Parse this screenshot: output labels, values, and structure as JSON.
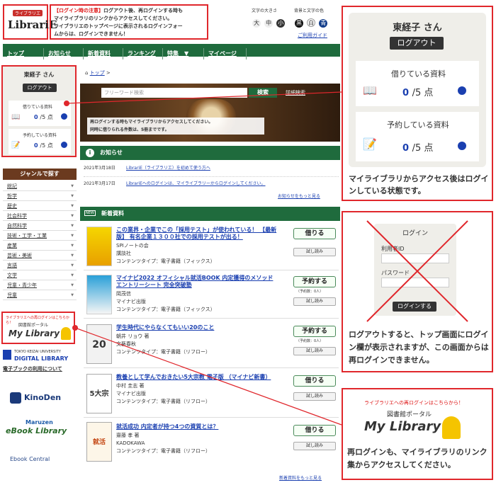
{
  "header": {
    "notice_title": "【ログイン時の注意】",
    "notice_lines": [
      "ログアウト後、再ログインする時も",
      "マイライブラリのリンクからアクセスしてください。",
      "ライブラリエのトップページに表示されるログインフォー",
      "ムからは、ログインできません！"
    ],
    "logo": "LibrariE",
    "logo_tag": "ライブラリエ",
    "text_size_label": "文字の大きさ",
    "text_sizes": [
      "大",
      "中",
      "小"
    ],
    "bg_label": "背景と文字の色",
    "bg_options": [
      "黒",
      "白",
      "青"
    ],
    "guide_link": "ご利用ガイド"
  },
  "nav": [
    "トップ",
    "お知らせ",
    "新着資料",
    "ランキング",
    "特集　▼",
    "マイページ"
  ],
  "user": {
    "name": "東経子 さん",
    "logout": "ログアウト",
    "borrowed_label": "借りている資料",
    "borrowed": "0",
    "borrowed_max": "/5 点",
    "reserved_label": "予約している資料",
    "reserved": "0",
    "reserved_max": "/5 点"
  },
  "sidebar": {
    "genre_title": "ジャンルで探す",
    "genres": [
      "総記",
      "哲学",
      "歴史",
      "社会科学",
      "自然科学",
      "技術・工学・工業",
      "産業",
      "芸術・美術",
      "言語",
      "文学",
      "児童・青少年",
      "児童"
    ],
    "mylib_note": "ライブラリエへの再ログインはこちらから！",
    "mylib_sub": "図書館ポータル",
    "mylib": "My Library",
    "dl_univ": "TOKYO KEIZAI UNIVERSITY",
    "dl_name": "DIGITAL LIBRARY",
    "ebook_use": "電子ブックの利用について",
    "kinoden": "KinoDen",
    "maruzen": "Maruzen",
    "ebook_library": "eBook Library",
    "ebook_central": "Ebook Central"
  },
  "main": {
    "breadcrumb": "トップ",
    "search_placeholder": "フリーワード検索",
    "search_btn": "検索",
    "advanced": "詳細検索",
    "hero_lines": [
      "再ログインする時もマイライブラリからアクセスしてください。",
      "同時に借りられる件数は、5冊までです。"
    ],
    "news_title": "お知らせ",
    "news": [
      {
        "date": "2021年3月18日",
        "text": "LibrariE（ライブラリエ）を初めて使う方へ"
      },
      {
        "date": "2021年3月17日",
        "text": "LibrariEへのログインは、マイライブラリーからログインしてください。"
      }
    ],
    "news_more": "お知らせをもっと見る",
    "new_title": "新着資料",
    "new_badge": "NEW",
    "more_new": "新着資料をもっと見る",
    "books": [
      {
        "title": "この業界・企業でこの「採用テスト」が使われている！ 【最新版】 有名企業１３００社での採用テストが出る！",
        "author": "SPIノートの会",
        "pub": "講談社",
        "type": "コンテンツタイプ：電子書籍（フィックス）",
        "action": "借りる",
        "trial": "試し読み",
        "reserve": ""
      },
      {
        "title": "マイナビ2022 オフィシャル就活BOOK 内定獲得のメソッド エントリーシート 完全突破塾",
        "author": "岡茂信",
        "pub": "マイナビ出版",
        "type": "コンテンツタイプ：電子書籍（フィックス）",
        "action": "予約する",
        "trial": "試し読み",
        "reserve": "（予約数：0人）"
      },
      {
        "title": "学生時代にやらなくてもいい20のこと",
        "author": "朝井 リョウ 著",
        "pub": "文藝春秋",
        "type": "コンテンツタイプ：電子書籍（リフロー）",
        "action": "予約する",
        "trial": "試し読み",
        "reserve": "（予約数：0人）"
      },
      {
        "title": "教養として学んでおきたい5大宗教 電子版 （マイナビ新書）",
        "author": "中村 圭志 著",
        "pub": "マイナビ出版",
        "type": "コンテンツタイプ：電子書籍（リフロー）",
        "action": "借りる",
        "trial": "試し読み",
        "reserve": ""
      },
      {
        "title": "就活成功 内定者が持つ4つの資質とは？",
        "author": "齋藤 孝 著",
        "pub": "KADOKAWA",
        "type": "コンテンツタイプ：電子書籍（リフロー）",
        "action": "借りる",
        "trial": "試し読み",
        "reserve": ""
      }
    ]
  },
  "callouts": {
    "c1_caption": "マイライブラリからアクセス後はログインしている状態です。",
    "login_title": "ログイン",
    "user_id": "利用者ID",
    "password": "パスワード",
    "login_btn": "ログインする",
    "c2_caption": "ログアウトすると、トップ画面にログイン欄が表示されますが、この画面からは再ログインできません。",
    "c3_note": "ライブラリエへの再ログインはこちらから！",
    "c3_sub": "図書館ポータル",
    "c3_title": "My Library",
    "c3_caption": "再ログインも、マイライブラリのリンク集からアクセスしてください。"
  }
}
